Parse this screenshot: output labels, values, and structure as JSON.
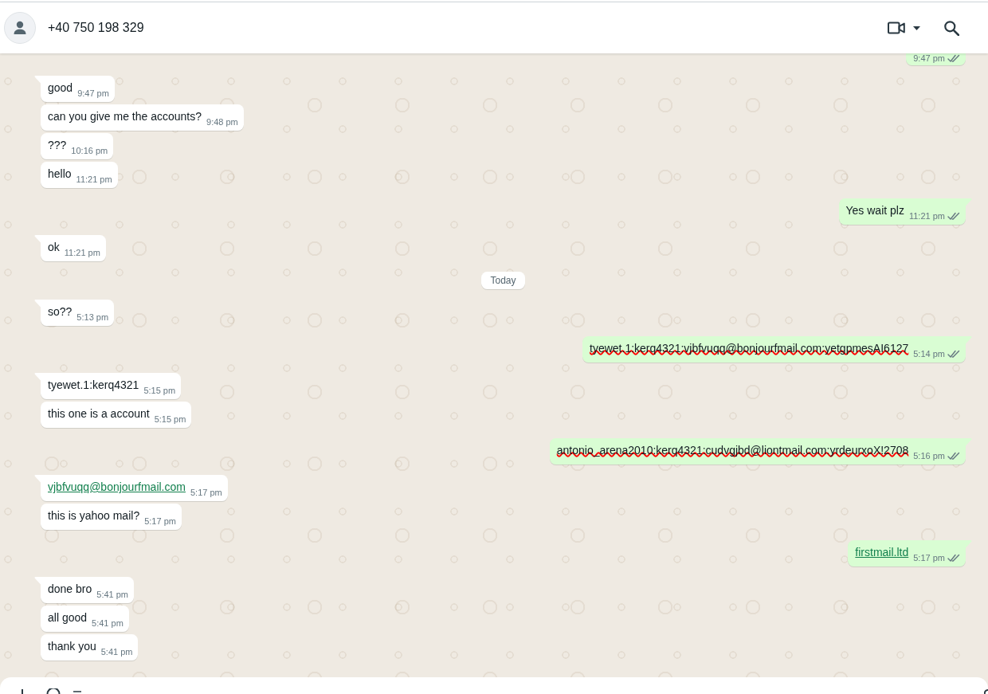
{
  "header": {
    "contact": "+40 750 198 329"
  },
  "messages": [
    {
      "outgoing": true,
      "kind": "text",
      "time": "9:47 pm",
      "read": false
    },
    {
      "outgoing": false,
      "kind": "text",
      "text": "good",
      "time": "9:47 pm"
    },
    {
      "outgoing": false,
      "kind": "text",
      "text": "can you give me the accounts?",
      "time": "9:48 pm"
    },
    {
      "outgoing": false,
      "kind": "text",
      "text": "???",
      "time": "10:16 pm"
    },
    {
      "outgoing": false,
      "kind": "text",
      "text": "hello",
      "time": "11:21 pm"
    },
    {
      "outgoing": true,
      "kind": "text",
      "text": "Yes wait plz",
      "time": "11:21 pm",
      "read": false
    },
    {
      "outgoing": false,
      "kind": "text",
      "text": "ok",
      "time": "11:21 pm"
    },
    {
      "kind": "date",
      "label": "Today"
    },
    {
      "outgoing": false,
      "kind": "text",
      "text": "so??",
      "time": "5:13 pm"
    },
    {
      "outgoing": true,
      "kind": "redacted",
      "text": "tyewet.1:kerq4321:vjbfvuqq@bonjourfmail.com:yetgpmesAI6127",
      "time": "5:14 pm",
      "read": false
    },
    {
      "outgoing": false,
      "kind": "text",
      "text": "tyewet.1:kerq4321",
      "time": "5:15 pm"
    },
    {
      "outgoing": false,
      "kind": "text",
      "text": "this one is a account",
      "time": "5:15 pm"
    },
    {
      "outgoing": true,
      "kind": "redacted",
      "text": "antonio_arena2010:kerq4321:cudvgjbd@liontmail.com:yrdeurxoX!2708",
      "time": "5:16 pm",
      "read": false
    },
    {
      "outgoing": false,
      "kind": "link",
      "text": "vjbfvuqq@bonjourfmail.com",
      "time": "5:17 pm"
    },
    {
      "outgoing": false,
      "kind": "text",
      "text": "this is yahoo mail?",
      "time": "5:17 pm"
    },
    {
      "outgoing": true,
      "kind": "link",
      "text": "firstmail.ltd",
      "time": "5:17 pm",
      "read": false
    },
    {
      "outgoing": false,
      "kind": "text",
      "text": "done bro",
      "time": "5:41 pm"
    },
    {
      "outgoing": false,
      "kind": "text",
      "text": "all good",
      "time": "5:41 pm"
    },
    {
      "outgoing": false,
      "kind": "text",
      "text": "thank you",
      "time": "5:41 pm"
    }
  ]
}
